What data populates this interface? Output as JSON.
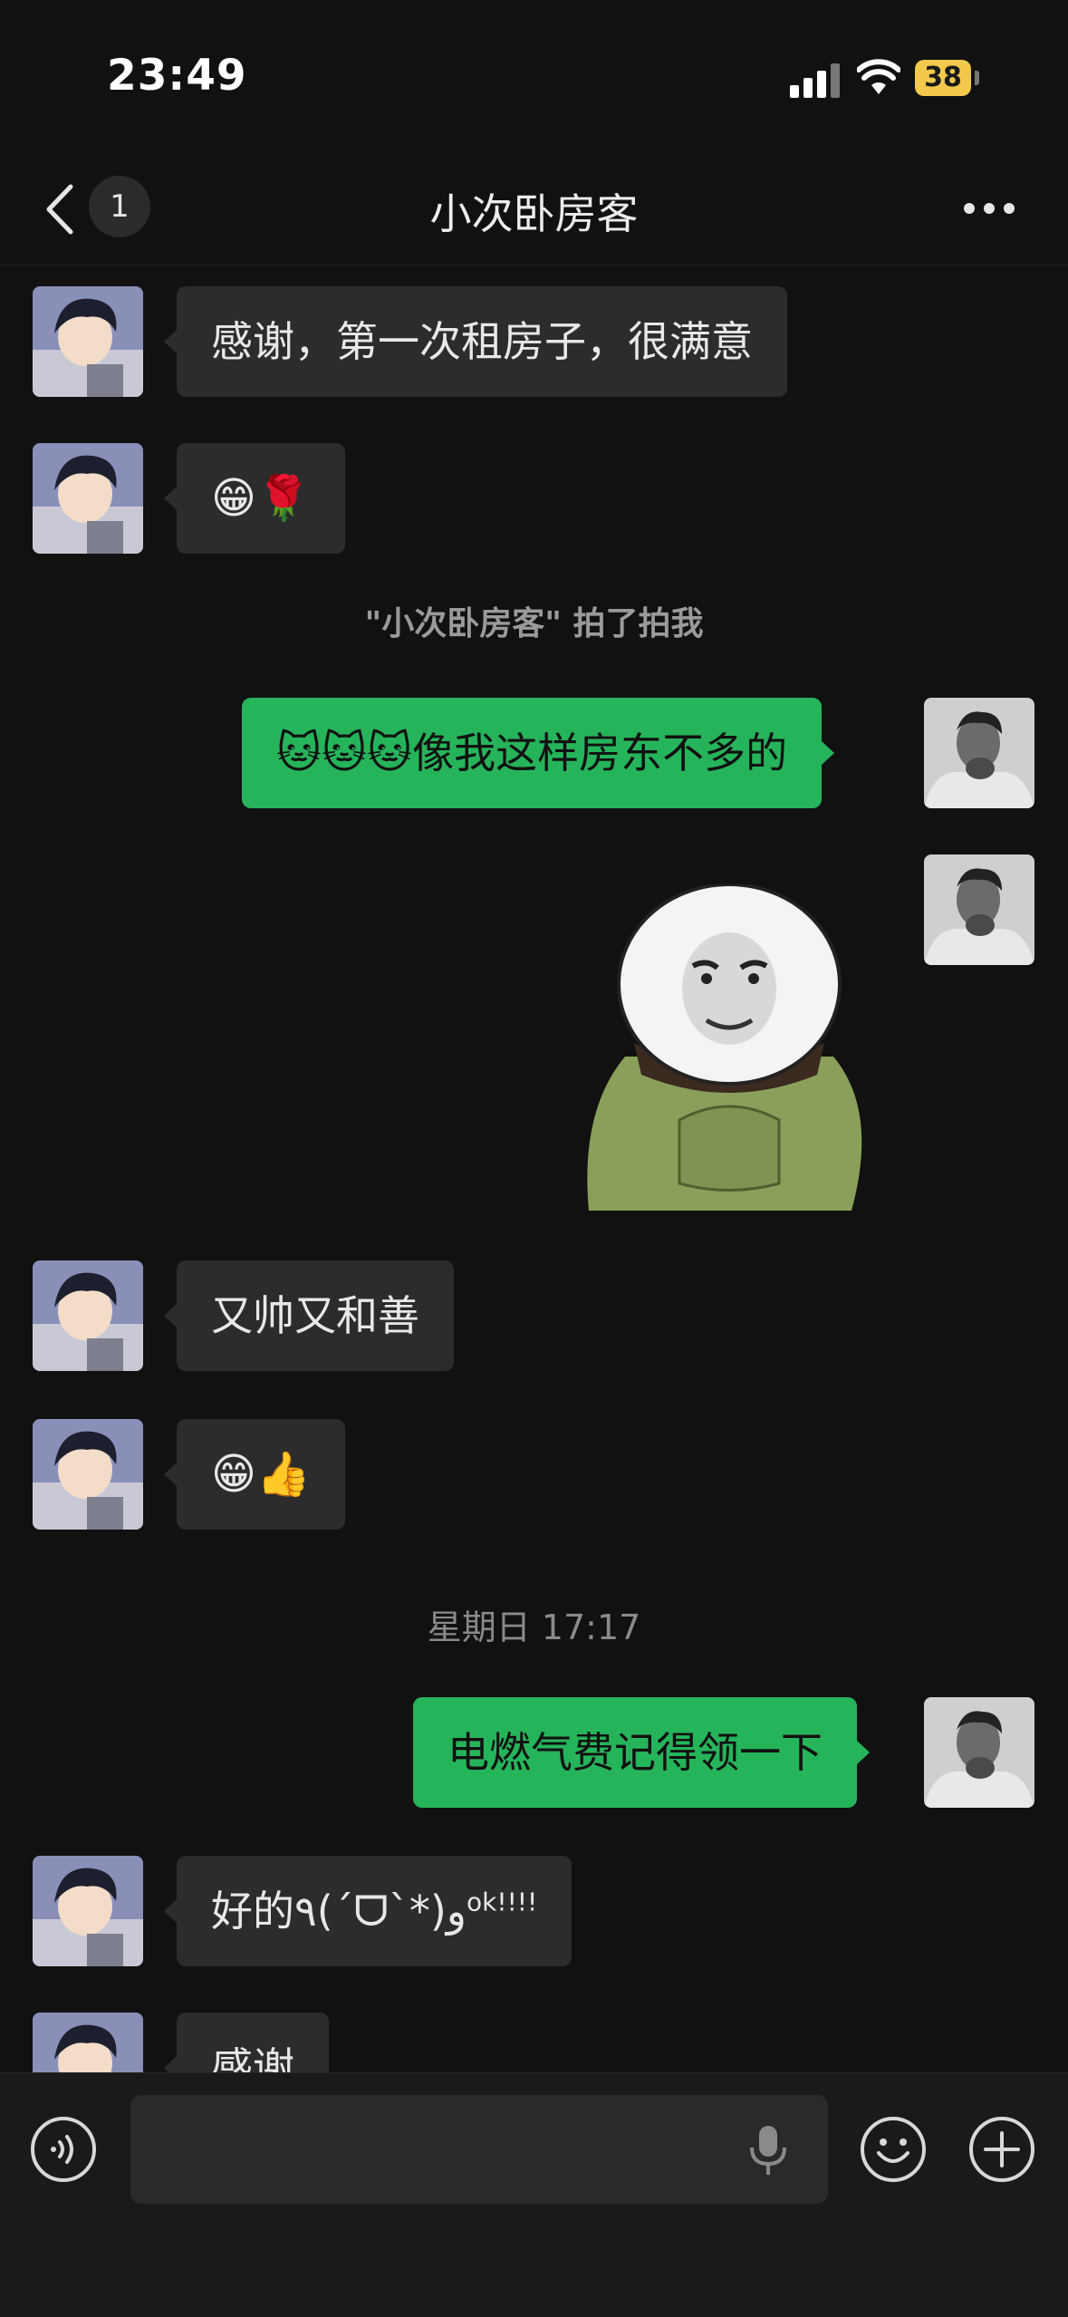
{
  "status_bar": {
    "time": "23:49",
    "battery": "38"
  },
  "nav": {
    "unread_count": "1",
    "title": "小次卧房客"
  },
  "messages": [
    {
      "text": "感谢，第一次租房子，很满意"
    },
    {
      "text": "😁🌹"
    },
    {
      "text": "\"小次卧房客\" 拍了拍我"
    },
    {
      "text_emoji": "🐱🐱🐱",
      "text": "像我这样房东不多的"
    },
    {
      "text": "又帅又和善"
    },
    {
      "text": "😁👍"
    },
    {
      "text": "星期日 17:17"
    },
    {
      "text": "电燃气费记得领一下"
    },
    {
      "text": "好的٩(ˊᗜˋ*)و",
      "sup": "ok!!!!"
    },
    {
      "text": "感谢"
    }
  ],
  "input": {
    "placeholder": ""
  },
  "colors": {
    "background": "#111111",
    "incoming_bubble": "#2c2c2c",
    "outgoing_bubble": "#26b45b",
    "battery": "#f2c94c"
  },
  "icons": [
    "back-icon",
    "more-icon",
    "voice-icon",
    "microphone-icon",
    "emoji-icon",
    "plus-icon"
  ]
}
